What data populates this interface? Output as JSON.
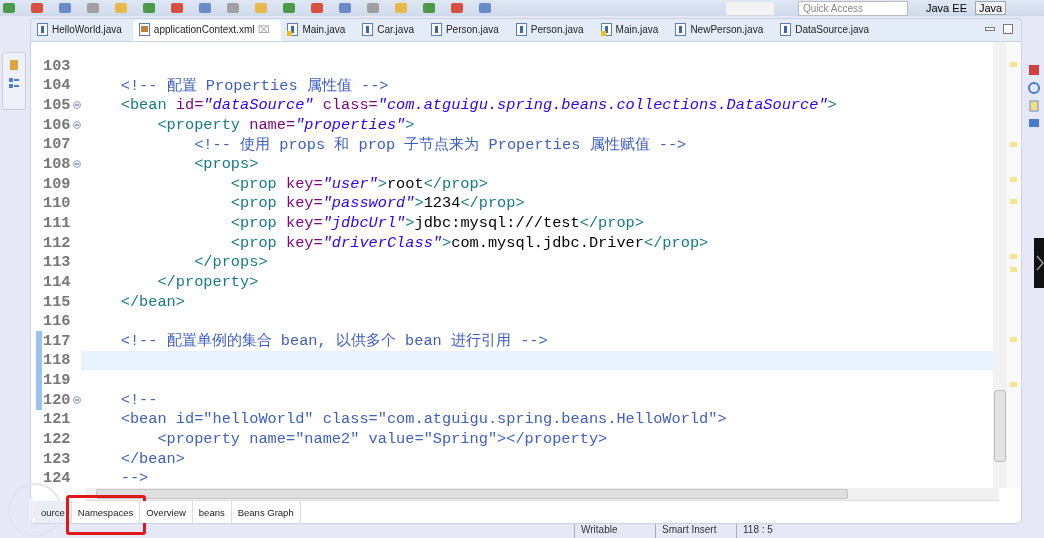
{
  "toolbar": {
    "quick_access": {
      "placeholder": "Quick Access"
    },
    "perspectives": [
      {
        "label": "Java EE",
        "selected": false
      },
      {
        "label": "Java",
        "selected": true
      }
    ]
  },
  "editor_tabs": [
    {
      "label": "HelloWorld.java",
      "kind": "java",
      "selected": false
    },
    {
      "label": "applicationContext.xml",
      "kind": "xml",
      "selected": true,
      "close": "⌧"
    },
    {
      "label": "Main.java",
      "kind": "java-warn",
      "selected": false
    },
    {
      "label": "Car.java",
      "kind": "java",
      "selected": false
    },
    {
      "label": "Person.java",
      "kind": "java",
      "selected": false
    },
    {
      "label": "Person.java",
      "kind": "java",
      "selected": false
    },
    {
      "label": "Main.java",
      "kind": "java-warn",
      "selected": false
    },
    {
      "label": "NewPerson.java",
      "kind": "java",
      "selected": false
    },
    {
      "label": "DataSource.java",
      "kind": "java",
      "selected": false
    }
  ],
  "editor": {
    "lines": [
      {
        "n": "103",
        "fold": false,
        "changed": false,
        "current": false
      },
      {
        "n": "104",
        "fold": false,
        "changed": false,
        "current": false,
        "tokens": [
          {
            "kind": "comment",
            "text": "    <!-- 配置 Properties 属性值 -->"
          }
        ]
      },
      {
        "n": "105",
        "fold": true,
        "changed": false,
        "current": false,
        "tokens": [
          {
            "kind": "tag",
            "text": "    <bean "
          },
          {
            "kind": "attr",
            "text": "id="
          },
          {
            "kind": "value",
            "text": "\"dataSource\""
          },
          {
            "kind": "attr",
            "text": " class="
          },
          {
            "kind": "value",
            "text": "\"com.atguigu.spring.beans.collections.DataSource\""
          },
          {
            "kind": "tag",
            "text": ">"
          }
        ]
      },
      {
        "n": "106",
        "fold": true,
        "changed": false,
        "current": false,
        "tokens": [
          {
            "kind": "tag",
            "text": "        <property "
          },
          {
            "kind": "attr",
            "text": "name="
          },
          {
            "kind": "value",
            "text": "\"properties\""
          },
          {
            "kind": "tag",
            "text": ">"
          }
        ]
      },
      {
        "n": "107",
        "fold": false,
        "changed": false,
        "current": false,
        "tokens": [
          {
            "kind": "comment",
            "text": "            <!-- 使用 props 和 prop 子节点来为 Properties 属性赋值 -->"
          }
        ]
      },
      {
        "n": "108",
        "fold": true,
        "changed": false,
        "current": false,
        "tokens": [
          {
            "kind": "tag",
            "text": "            <props>"
          }
        ]
      },
      {
        "n": "109",
        "fold": false,
        "changed": false,
        "current": false,
        "tokens": [
          {
            "kind": "tag",
            "text": "                <prop "
          },
          {
            "kind": "attr",
            "text": "key="
          },
          {
            "kind": "value",
            "text": "\"user\""
          },
          {
            "kind": "tag",
            "text": ">"
          },
          {
            "kind": "text",
            "text": "root"
          },
          {
            "kind": "tag",
            "text": "</prop>"
          }
        ]
      },
      {
        "n": "110",
        "fold": false,
        "changed": false,
        "current": false,
        "tokens": [
          {
            "kind": "tag",
            "text": "                <prop "
          },
          {
            "kind": "attr",
            "text": "key="
          },
          {
            "kind": "value",
            "text": "\"password\""
          },
          {
            "kind": "tag",
            "text": ">"
          },
          {
            "kind": "text",
            "text": "1234"
          },
          {
            "kind": "tag",
            "text": "</prop>"
          }
        ]
      },
      {
        "n": "111",
        "fold": false,
        "changed": false,
        "current": false,
        "tokens": [
          {
            "kind": "tag",
            "text": "                <prop "
          },
          {
            "kind": "attr",
            "text": "key="
          },
          {
            "kind": "value",
            "text": "\"jdbcUrl\""
          },
          {
            "kind": "tag",
            "text": ">"
          },
          {
            "kind": "text",
            "text": "jdbc:mysql:///test"
          },
          {
            "kind": "tag",
            "text": "</prop>"
          }
        ]
      },
      {
        "n": "112",
        "fold": false,
        "changed": false,
        "current": false,
        "tokens": [
          {
            "kind": "tag",
            "text": "                <prop "
          },
          {
            "kind": "attr",
            "text": "key="
          },
          {
            "kind": "value",
            "text": "\"driverClass\""
          },
          {
            "kind": "tag",
            "text": ">"
          },
          {
            "kind": "text",
            "text": "com.mysql.jdbc.Driver"
          },
          {
            "kind": "tag",
            "text": "</prop>"
          }
        ]
      },
      {
        "n": "113",
        "fold": false,
        "changed": false,
        "current": false,
        "tokens": [
          {
            "kind": "tag",
            "text": "            </props>"
          }
        ]
      },
      {
        "n": "114",
        "fold": false,
        "changed": false,
        "current": false,
        "tokens": [
          {
            "kind": "tag",
            "text": "        </property>"
          }
        ]
      },
      {
        "n": "115",
        "fold": false,
        "changed": false,
        "current": false,
        "tokens": [
          {
            "kind": "tag",
            "text": "    </bean>"
          }
        ]
      },
      {
        "n": "116",
        "fold": false,
        "changed": false,
        "current": false
      },
      {
        "n": "117",
        "fold": false,
        "changed": true,
        "current": false,
        "tokens": [
          {
            "kind": "comment",
            "text": "    <!-- 配置单例的集合 bean, 以供多个 bean 进行引用 -->"
          }
        ]
      },
      {
        "n": "118",
        "fold": false,
        "changed": true,
        "current": true
      },
      {
        "n": "119",
        "fold": false,
        "changed": true,
        "current": false
      },
      {
        "n": "120",
        "fold": true,
        "changed": true,
        "current": false,
        "tokens": [
          {
            "kind": "comment",
            "text": "    <!--"
          }
        ]
      },
      {
        "n": "121",
        "fold": false,
        "changed": false,
        "current": false,
        "tokens": [
          {
            "kind": "comment",
            "text": "    <bean id=\"helloWorld\" class=\"com.atguigu.spring.beans.HelloWorld\">"
          }
        ]
      },
      {
        "n": "122",
        "fold": false,
        "changed": false,
        "current": false,
        "tokens": [
          {
            "kind": "comment",
            "text": "        <property name=\"name2\" value=\"Spring\"></property>"
          }
        ]
      },
      {
        "n": "123",
        "fold": false,
        "changed": false,
        "current": false,
        "tokens": [
          {
            "kind": "comment",
            "text": "    </bean>"
          }
        ]
      },
      {
        "n": "124",
        "fold": false,
        "changed": false,
        "current": false,
        "tokens": [
          {
            "kind": "comment",
            "text": "    -->"
          }
        ]
      }
    ]
  },
  "page_tabs": [
    {
      "label": "ource",
      "selected": true
    },
    {
      "label": "Namespaces",
      "selected": false
    },
    {
      "label": "Overview",
      "selected": false
    },
    {
      "label": "beans",
      "selected": false
    },
    {
      "label": "Beans Graph",
      "selected": false
    }
  ],
  "status_bar": [
    "Writable",
    "Smart Insert",
    "118 : 5"
  ]
}
